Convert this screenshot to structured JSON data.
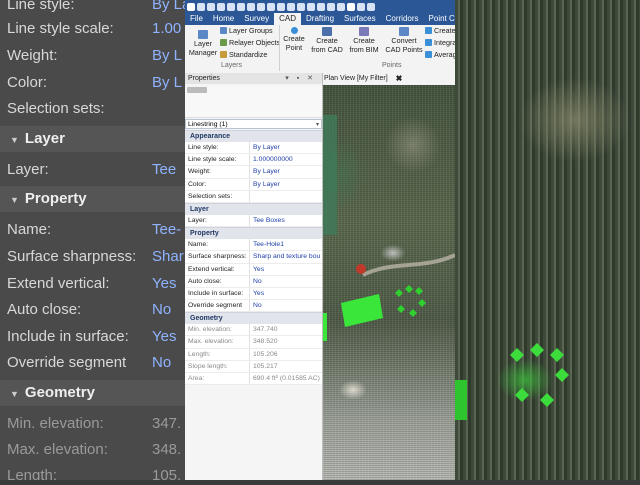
{
  "app": {
    "tabs": [
      "File",
      "Home",
      "Survey",
      "CAD",
      "Drafting",
      "Surfaces",
      "Corridors",
      "Point Clou"
    ],
    "active_tab": "CAD"
  },
  "ribbon": {
    "layer_manager": "Layer\nManager",
    "layer_groups": "Layer Groups",
    "relayer_objects": "Relayer Objects",
    "standardize": "Standardize",
    "layers_group": "Layers",
    "create_point": "Create\nPoint",
    "create_from_cad": "Create\nfrom CAD",
    "create_from_bim": "Create\nfrom BIM",
    "convert_cad_points": "Convert\nCAD Points",
    "create_small": "Create",
    "integra": "Integra",
    "average": "Averag",
    "points_group": "Points"
  },
  "properties": {
    "title": "Properties",
    "selection": "Linestring (1)",
    "appearance_header": "Appearance",
    "appearance": [
      {
        "k": "Line style:",
        "v": "By Layer"
      },
      {
        "k": "Line style scale:",
        "v": "1.000000000"
      },
      {
        "k": "Weight:",
        "v": "By Layer"
      },
      {
        "k": "Color:",
        "v": "By Layer"
      },
      {
        "k": "Selection sets:",
        "v": ""
      }
    ],
    "layer_header": "Layer",
    "layer": [
      {
        "k": "Layer:",
        "v": "Tee Boxes"
      }
    ],
    "property_header": "Property",
    "property": [
      {
        "k": "Name:",
        "v": "Tee-Hole1"
      },
      {
        "k": "Surface sharpness:",
        "v": "Sharp and texture bou"
      },
      {
        "k": "Extend vertical:",
        "v": "Yes"
      },
      {
        "k": "Auto close:",
        "v": "No"
      },
      {
        "k": "Include in surface:",
        "v": "Yes"
      },
      {
        "k": "Override segment",
        "v": "No"
      }
    ],
    "geometry_header": "Geometry",
    "geometry": [
      {
        "k": "Min. elevation:",
        "v": "347.740"
      },
      {
        "k": "Max. elevation:",
        "v": "348.520"
      },
      {
        "k": "Length:",
        "v": "105.206"
      },
      {
        "k": "Slope length:",
        "v": "105.217"
      },
      {
        "k": "Area:",
        "v": "690.4 ft² (0.01585 AC)"
      }
    ]
  },
  "plan_view": {
    "tab_label": "Plan View [My Filter]",
    "close_glyph": "✖"
  },
  "background_zoom": {
    "rows": [
      {
        "k": "Line style:",
        "v": "By La"
      },
      {
        "k": "Line style scale:",
        "v": "1.00"
      },
      {
        "k": "Weight:",
        "v": "By L"
      },
      {
        "k": "Color:",
        "v": "By L"
      },
      {
        "k": "Selection sets:",
        "v": ""
      }
    ],
    "layer_header": "Layer",
    "layer_row": {
      "k": "Layer:",
      "v": "Tee"
    },
    "property_header": "Property",
    "property_rows": [
      {
        "k": "Name:",
        "v": "Tee-"
      },
      {
        "k": "Surface sharpness:",
        "v": "Shar"
      },
      {
        "k": "Extend vertical:",
        "v": "Yes"
      },
      {
        "k": "Auto close:",
        "v": "No"
      },
      {
        "k": "Include in surface:",
        "v": "Yes"
      },
      {
        "k": "Override segment",
        "v": "No"
      }
    ],
    "geometry_header": "Geometry",
    "geometry_rows": [
      {
        "k": "Min. elevation:",
        "v": "347."
      },
      {
        "k": "Max. elevation:",
        "v": "348."
      },
      {
        "k": "Length:",
        "v": "105."
      }
    ]
  },
  "colors": {
    "title_bar": "#2b5797",
    "value_blue": "#1f3fa8",
    "tee_box_green": "#39e639",
    "marker_red": "#c0392b"
  }
}
